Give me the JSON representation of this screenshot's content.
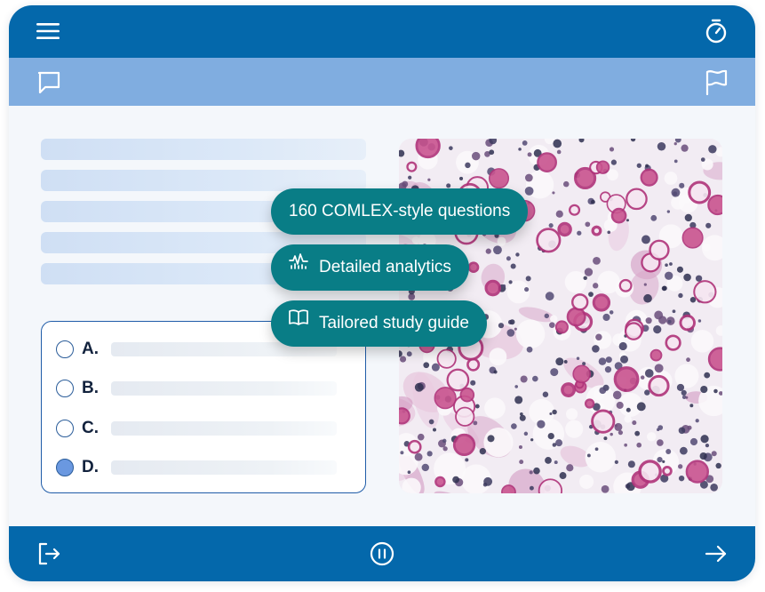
{
  "header": {
    "menu_icon": "hamburger-menu-icon",
    "timer_icon": "stopwatch-icon",
    "color": "#0468ab"
  },
  "subbar": {
    "comment_icon": "speech-bubble-icon",
    "flag_icon": "flag-icon",
    "color": "#80ade0"
  },
  "question": {
    "stem_lines": 5
  },
  "answers": [
    {
      "letter": "A.",
      "selected": false
    },
    {
      "letter": "B.",
      "selected": false
    },
    {
      "letter": "C.",
      "selected": false
    },
    {
      "letter": "D.",
      "selected": true
    }
  ],
  "image": {
    "icon": "histology-micrograph-image"
  },
  "features": [
    {
      "label": "160 COMLEX-style questions",
      "icon": ""
    },
    {
      "label": "Detailed analytics",
      "icon": "analytics-chart-icon"
    },
    {
      "label": "Tailored study guide",
      "icon": "open-book-icon"
    }
  ],
  "footer": {
    "exit_icon": "exit-icon",
    "pause_icon": "pause-icon",
    "next_icon": "arrow-right-icon",
    "color": "#0468ab"
  },
  "colors": {
    "accent": "#097d86",
    "selected_radio": "#6a98e0",
    "border": "#1f5ca8"
  }
}
